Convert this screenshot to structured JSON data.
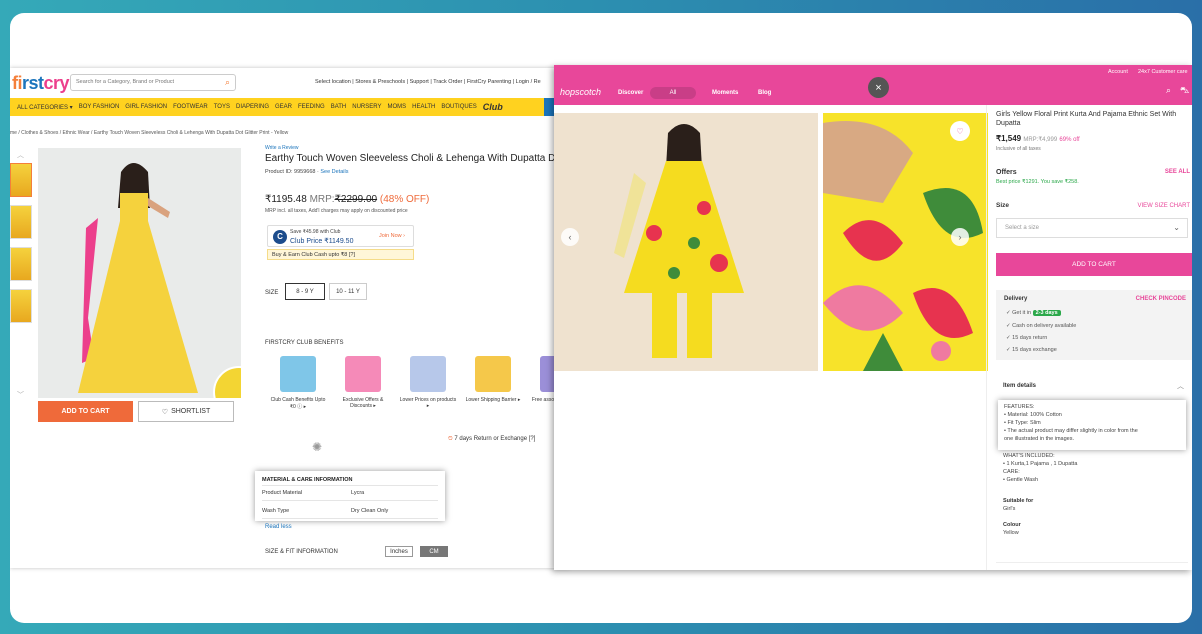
{
  "firstcry": {
    "logo": "firstcry",
    "search_placeholder": "Search for a Category, Brand or Product",
    "top_links": "Select location | Stores & Preschools | Support | Track Order | FirstCry Parenting | Login / Re",
    "nav": [
      "ALL CATEGORIES ▾",
      "BOY FASHION",
      "GIRL FASHION",
      "FOOTWEAR",
      "TOYS",
      "DIAPERING",
      "GEAR",
      "FEEDING",
      "BATH",
      "NURSERY",
      "MOMS",
      "HEALTH",
      "BOUTIQUES"
    ],
    "club_label": "Club",
    "breadcrumb": "me / Clothes & Shoes / Ethnic Wear / Earthy Touch Woven Sleeveless Choli & Lehenga With Dupatta Dot Glitter Print - Yellow",
    "write_review": "Write a Review",
    "title": "Earthy Touch Woven Sleeveless Choli & Lehenga With Dupatta Dot Glit",
    "product_id": "Product ID: 9959668 · ",
    "see_details": "See Details",
    "price": "₹1195.48",
    "mrp_label": "MRP:",
    "mrp": "₹2299.00",
    "discount": "(48% OFF)",
    "tax_note": "MRP incl. all taxes, Add'l charges may apply on discounted price",
    "club_save": "Save ₹45.98 with Club",
    "club_price": "Club Price  ₹1149.50",
    "join_now": "Join Now ›",
    "club_cash": "Buy & Earn Club Cash upto ₹8 [?]",
    "size_label": "SIZE",
    "sizes": [
      "8 - 9 Y",
      "10 - 11 Y"
    ],
    "add_to_cart": "ADD TO CART",
    "shortlist": "SHORTLIST",
    "benefits_heading": "FIRSTCRY CLUB BENEFITS",
    "benefits": [
      {
        "label": "Club Cash Benefits Upto ₹0 ⓘ ▸",
        "color": "#7fc6e8"
      },
      {
        "label": "Exclusive Offers & Discounts ▸",
        "color": "#f58ab8"
      },
      {
        "label": "Lower Prices on products ▸",
        "color": "#b7c8ea"
      },
      {
        "label": "Lower Shipping Barrier ▸",
        "color": "#f5c84a"
      },
      {
        "label": "Free asso",
        "color": "#9b8fd8"
      }
    ],
    "returns": "7 days Return or Exchange [?]",
    "material_heading": "MATERIAL & CARE INFORMATION",
    "material_rows": [
      {
        "k": "Product Material",
        "v": "Lycra"
      },
      {
        "k": "Wash Type",
        "v": "Dry Clean Only"
      }
    ],
    "read_less": "Read less",
    "size_fit": "SIZE & FIT INFORMATION",
    "units": [
      "Inches",
      "CM"
    ]
  },
  "hopscotch": {
    "logo": "hopscotch",
    "nav_discover": "Discover",
    "nav_all": "All",
    "nav_moments": "Moments",
    "nav_blog": "Blog",
    "account": "Account",
    "support": "24x7 Customer care",
    "close": "×",
    "title": "Girls Yellow Floral Print Kurta And Pajama Ethnic Set With Dupatta",
    "price": "₹1,549",
    "mrp": "MRP:₹4,999",
    "discount": "69% off",
    "tax": "Inclusive of all taxes",
    "offers": "Offers",
    "see_all": "SEE ALL",
    "best_price": "Best price ₹1291. You save ₹258.",
    "size": "Size",
    "view_size_chart": "VIEW SIZE CHART",
    "select_size": "Select a size",
    "add_to_cart": "ADD TO CART",
    "delivery": "Delivery",
    "check_pincode": "CHECK PINCODE",
    "get_it_in": "✓ Get it in",
    "days": "2-3 days",
    "delivery_points": [
      "✓ Cash on delivery available",
      "✓ 15 days return",
      "✓ 15 days exchange"
    ],
    "item_details": "Item details",
    "features_heading": "FEATURES:",
    "features": [
      "•  Material: 100% Cotton",
      "•  Fit Type: Slim",
      "•  The actual product may differ slightly in color from the",
      "    one illustrated in the images."
    ],
    "whats_included_h": "WHAT'S INCLUDED:",
    "whats_included": "•  1 Kurta,1 Pajama , 1 Dupatta",
    "care_h": "CARE:",
    "care": "•  Gentle Wash",
    "suitable_h": "Suitable for",
    "suitable": "Girl's",
    "colour_h": "Colour",
    "colour": "Yellow"
  },
  "colors": {
    "firstcry_orange": "#ef6a3a",
    "firstcry_yellow": "#ffd21f",
    "hopscotch_pink": "#e8479a",
    "green": "#2ba84a"
  }
}
